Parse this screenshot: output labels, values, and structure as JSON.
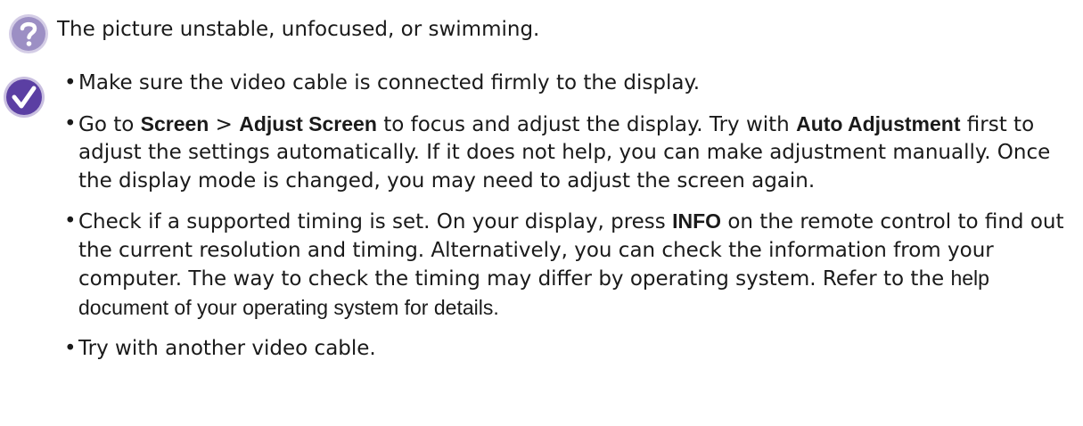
{
  "question": {
    "icon": "question-icon",
    "text": "The picture unstable, unfocused, or swimming."
  },
  "answer": {
    "icon": "check-icon",
    "bullet_glyph": "•",
    "items": [
      {
        "text": "Make sure the video cable is connected firmly to the display."
      },
      {
        "part1": "Go to ",
        "bold1": "Screen",
        "part2": " > ",
        "bold2": "Adjust Screen",
        "part3": " to focus and adjust the display. Try with ",
        "bold3": "Auto Adjustment",
        "part4": " first to adjust the settings automatically. If it does not help, you can make adjustment manually. Once the display mode is changed, you may need to adjust the screen again."
      },
      {
        "part1": "Check if a supported timing is set. On your display, press ",
        "bold1": "INFO",
        "part2": " on the remote control to find out the current resolution and timing. Alternatively, you can check the information from your computer. The way to check the timing may differ by operating system. Refer to the ",
        "part3": "help document of your operating system for details."
      },
      {
        "text": "Try with another video cable."
      }
    ]
  },
  "colors": {
    "question_icon_fill": "#9c8fc4",
    "question_icon_ring": "#d4cde6",
    "check_icon_fill": "#5b3fa3",
    "check_icon_ring": "#c9bfe0",
    "text": "#1a1a1a"
  }
}
